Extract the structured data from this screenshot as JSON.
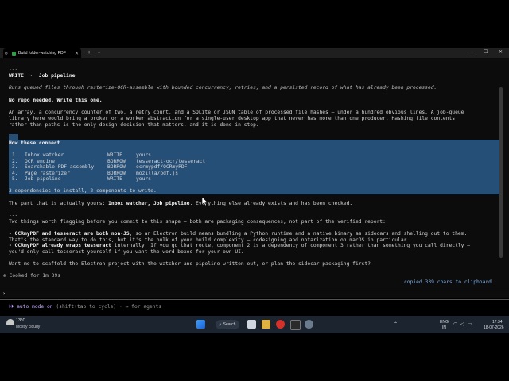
{
  "window": {
    "tab_title": "Build folder-watching PDF",
    "new_tab": "+",
    "dropdown": "⌄",
    "minimize": "—",
    "maximize": "☐",
    "close": "✕"
  },
  "transcript": {
    "rule1": "---",
    "heading": "WRITE  ·  Job pipeline",
    "summary": "Runs queued files through rasterize-OCR-assemble with bounded concurrency, retries, and a persisted record of what has already been processed.",
    "no_repo": "No repo needed. Write this one.",
    "para1_l1": "An array, a concurrency counter of two, a retry count, and a SQLite or JSON table of processed file hashes — under a hundred obvious lines. A job-queue",
    "para1_l2": "library here would bring a broker or a worker abstraction for a single-user desktop app that never has more than one producer. Hashing file contents",
    "para1_l3": "rather than paths is the only design decision that matters, and it is done in step.",
    "rule2": "---",
    "connect_heading": "How these connect",
    "components": [
      {
        "num": "1.",
        "name": "Inbox watcher",
        "action": "WRITE",
        "source": "yours"
      },
      {
        "num": "2.",
        "name": "OCR engine",
        "action": "BORROW",
        "source": "tesseract-ocr/tesseract"
      },
      {
        "num": "3.",
        "name": "Searchable-PDF assembly",
        "action": "BORROW",
        "source": "ocrmypdf/OCRmyPDF"
      },
      {
        "num": "4.",
        "name": "Page rasterizer",
        "action": "BORROW",
        "source": "mozilla/pdf.js"
      },
      {
        "num": "5.",
        "name": "Job pipeline",
        "action": "WRITE",
        "source": "yours"
      }
    ],
    "deps_line": "3 dependencies to install, 2 components to write.",
    "yours_pre": "The part that is actually yours: ",
    "yours_bold": "Inbox watcher, Job pipeline",
    "yours_post": ". Everything else already exists and has been checked.",
    "rule3": "---",
    "flag_intro": "Two things worth flagging before you commit to this shape — both are packaging consequences, not part of the verified report:",
    "flag1_bold": "- OCRmyPDF and tesseract are both non-JS",
    "flag1_rest": ", so an Electron build means bundling a Python runtime and a native binary as sidecars and shelling out to them.",
    "flag1_l2": "That's the standard way to do this, but it's the bulk of your build complexity — codesigning and notarization on macOS in particular.",
    "flag2_bold": "- OCRmyPDF already wraps tesseract",
    "flag2_rest": " internally. If you go that route, component 2 is a dependency of component 3 rather than something you call directly —",
    "flag2_l2": "you'd only call tesseract yourself if you want the word boxes for your own UI.",
    "question": "Want me to scaffold the Electron project with the watcher and pipeline written out, or plan the sidecar packaging first?",
    "cooked": "✻ Cooked for 1m 39s",
    "copied": "copied 339 chars to clipboard"
  },
  "prompt": {
    "char": "›",
    "mode_prefix": "⏵⏵ ",
    "mode_bold": "auto mode on",
    "mode_rest": " (shift+tab to cycle) · ↵ for agents"
  },
  "taskbar": {
    "temp": "13°C",
    "condition": "Mostly cloudy",
    "search": "Search",
    "lang1": "ENG",
    "lang2": "IN",
    "time": "17:34",
    "date": "18-07-2026"
  },
  "colors": {
    "selection": "#264f78",
    "background": "#0c0c0c",
    "link": "#7fb0e8"
  }
}
